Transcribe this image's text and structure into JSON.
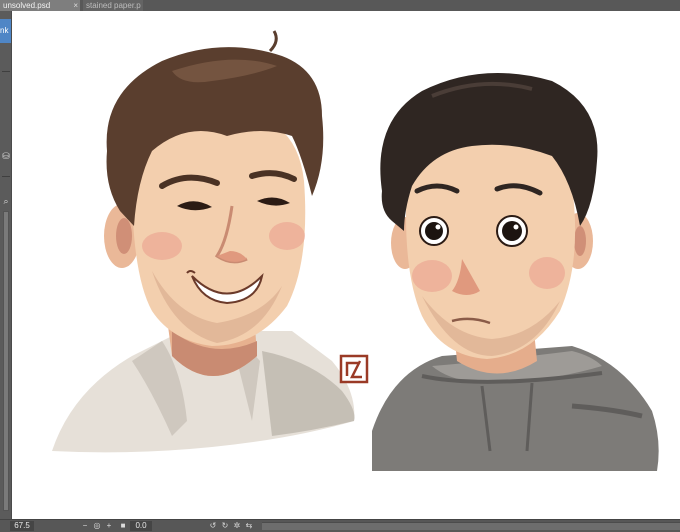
{
  "tabs": [
    {
      "label": "unsolved.psd",
      "active": true
    },
    {
      "label": "stained paper.p",
      "active": false
    }
  ],
  "leftbar": {
    "ink_label": "nk"
  },
  "statusbar": {
    "zoom": "67.5",
    "angle": "0.0"
  },
  "canvas": {
    "background": "#ffffff",
    "description_icons": [
      "close-icon",
      "bucket-icon",
      "search-icon",
      "lock-icon"
    ]
  },
  "signature": {
    "glyph": "ᗋ"
  }
}
